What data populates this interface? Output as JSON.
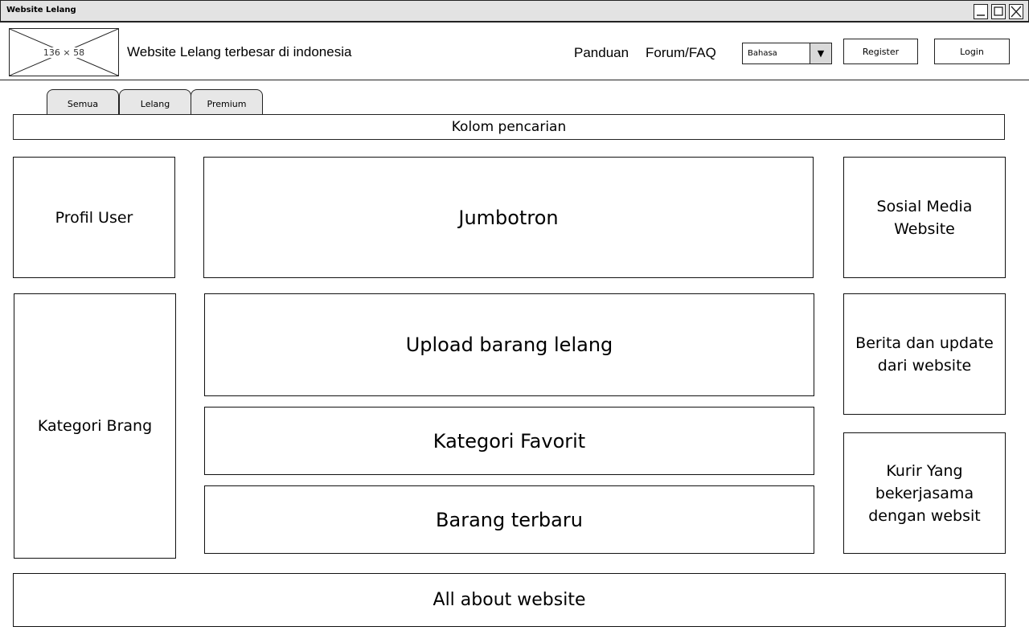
{
  "window": {
    "title": "Website Lelang"
  },
  "header": {
    "logo_placeholder": "136 × 58",
    "site_title": "Website Lelang terbesar di indonesia",
    "nav": {
      "panduan": "Panduan",
      "forum": "Forum/FAQ"
    },
    "language_select": {
      "value": "Bahasa",
      "arrow": "▼"
    },
    "register_label": "Register",
    "login_label": "Login"
  },
  "tabs": [
    "Semua",
    "Lelang",
    "Premium"
  ],
  "search": {
    "label": "Kolom pencarian"
  },
  "panels": {
    "profil_user": "Profil User",
    "jumbotron": "Jumbotron",
    "sosial_media": "Sosial Media Website",
    "kategori_barang": "Kategori Brang",
    "upload": "Upload barang lelang",
    "berita": "Berita dan update dari website",
    "kategori_favorit": "Kategori Favorit",
    "barang_terbaru": "Barang terbaru",
    "kurir": "Kurir Yang bekerjasama dengan websit",
    "footer": "All about website"
  },
  "icons": {
    "minimize": "minimize-icon",
    "maximize": "maximize-icon",
    "close": "close-icon"
  }
}
